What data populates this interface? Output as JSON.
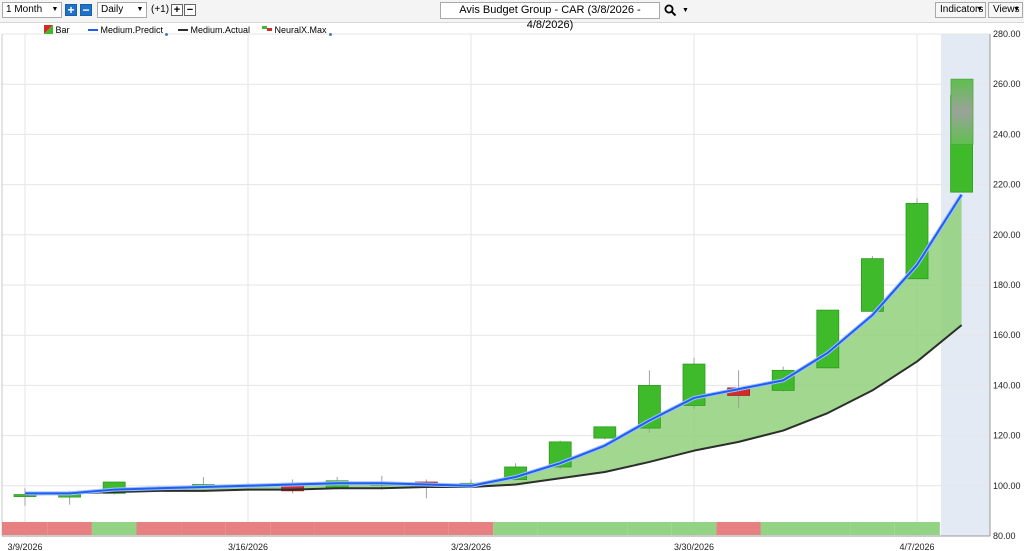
{
  "toolbar": {
    "range": "1 Month",
    "interval": "Daily",
    "offset": "(+1)",
    "title": "Avis Budget Group - CAR (3/8/2026 - 4/8/2026)",
    "indicators": "Indicators",
    "views": "Views"
  },
  "colors": {
    "up": "#3fba2b",
    "down": "#d42a2a",
    "predict": "#1f5ef0",
    "actual": "#2b2f2b",
    "fill": "#90d07a",
    "signal_green": "#92d484",
    "signal_red": "#e78080",
    "forecast_panel": "#e3eaf4"
  },
  "chart_data": {
    "type": "candlestick",
    "ylim": [
      80,
      280
    ],
    "yticks": [
      "280.00",
      "260.00",
      "240.00",
      "220.00",
      "200.00",
      "180.00",
      "160.00",
      "140.00",
      "120.00",
      "100.00",
      "80.00"
    ],
    "xtick_labels": [
      "3/9/2026",
      "3/16/2026",
      "3/23/2026",
      "3/30/2026",
      "4/7/2026"
    ],
    "xtick_index": [
      0,
      5,
      10,
      15,
      20
    ],
    "legend": [
      "Bar",
      "Medium.Predict",
      "Medium.Actual",
      "NeuralX.Max"
    ],
    "candles": [
      {
        "o": 96.5,
        "h": 99,
        "l": 92,
        "c": 96.5
      },
      {
        "o": 95.5,
        "h": 98,
        "l": 92.5,
        "c": 96.5
      },
      {
        "o": 97,
        "h": 101.5,
        "l": 96.5,
        "c": 101.5
      },
      {
        "o": 99,
        "h": 100,
        "l": 98,
        "c": 99.5
      },
      {
        "o": 99.5,
        "h": 103.5,
        "l": 98.5,
        "c": 100.5
      },
      {
        "o": 99.5,
        "h": 101,
        "l": 98.5,
        "c": 100.5
      },
      {
        "o": 101,
        "h": 102.5,
        "l": 97,
        "c": 98
      },
      {
        "o": 99,
        "h": 103.5,
        "l": 98.5,
        "c": 102
      },
      {
        "o": 101,
        "h": 104,
        "l": 98.5,
        "c": 101
      },
      {
        "o": 101.5,
        "h": 102.5,
        "l": 95,
        "c": 100
      },
      {
        "o": 101,
        "h": 102.5,
        "l": 99.5,
        "c": 101
      },
      {
        "o": 102.5,
        "h": 109,
        "l": 102,
        "c": 107.5
      },
      {
        "o": 107.5,
        "h": 118,
        "l": 106.5,
        "c": 117.5
      },
      {
        "o": 119,
        "h": 123.5,
        "l": 118.5,
        "c": 123.5
      },
      {
        "o": 123,
        "h": 146,
        "l": 121,
        "c": 140
      },
      {
        "o": 132,
        "h": 151,
        "l": 130.5,
        "c": 148.5
      },
      {
        "o": 139,
        "h": 146,
        "l": 131,
        "c": 136
      },
      {
        "o": 138,
        "h": 147.5,
        "l": 137.5,
        "c": 146
      },
      {
        "o": 147,
        "h": 170,
        "l": 147,
        "c": 170
      },
      {
        "o": 169.5,
        "h": 191.5,
        "l": 169.5,
        "c": 190.5
      },
      {
        "o": 182.5,
        "h": 214.5,
        "l": 182.5,
        "c": 212.5
      },
      {
        "o": 217,
        "h": 257,
        "l": 217,
        "c": 255.5
      }
    ],
    "forecast": {
      "o": 236,
      "c": 262
    },
    "series": [
      {
        "name": "Medium.Predict",
        "values": [
          97,
          97,
          98.5,
          99,
          99.5,
          100,
          100.5,
          101,
          101,
          100.5,
          100,
          103.5,
          109,
          116,
          126,
          135,
          138.5,
          142,
          153,
          168,
          188,
          216
        ]
      },
      {
        "name": "Medium.Actual",
        "values": [
          96.5,
          97,
          97.5,
          98,
          98,
          98.5,
          98.5,
          99,
          99,
          99.5,
          99.5,
          100.5,
          103,
          105.5,
          109.5,
          114,
          117.5,
          122,
          129,
          138,
          149.5,
          164
        ]
      }
    ],
    "signals": [
      "red",
      "red",
      "green",
      "red",
      "red",
      "red",
      "red",
      "red",
      "red",
      "red",
      "red",
      "green",
      "green",
      "green",
      "green",
      "green",
      "red",
      "green",
      "green",
      "green",
      "green",
      "green"
    ]
  }
}
